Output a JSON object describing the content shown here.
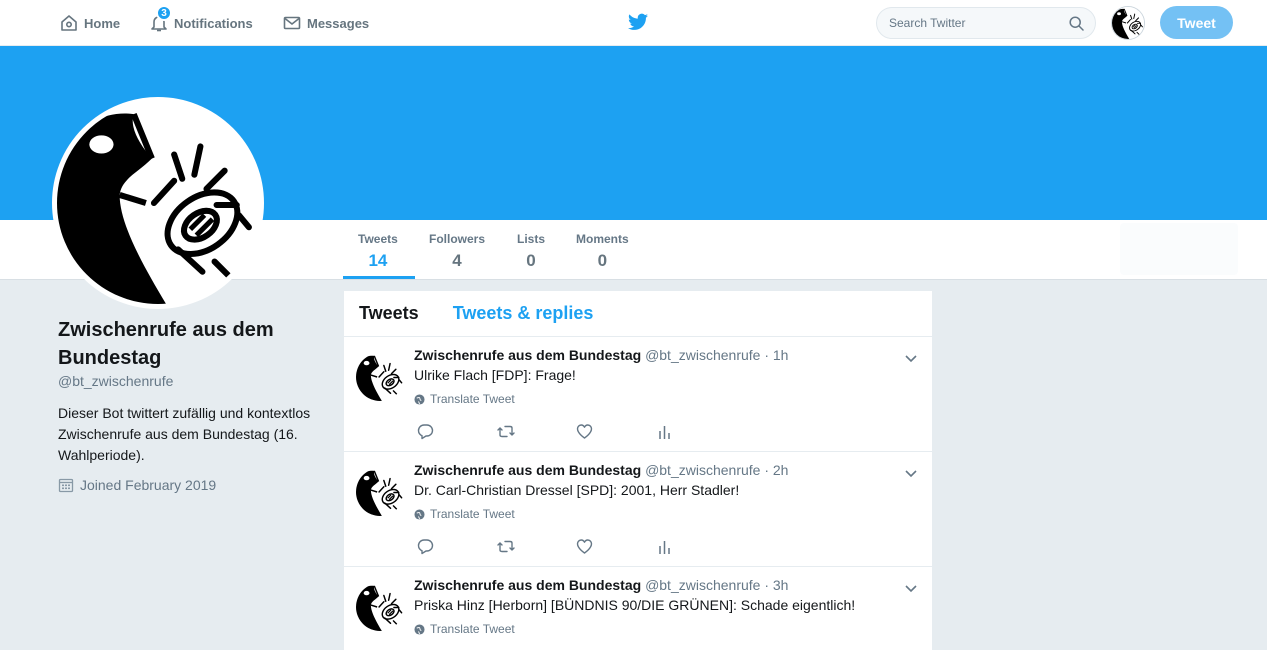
{
  "nav": {
    "home": "Home",
    "notifications": "Notifications",
    "notifications_badge": "3",
    "messages": "Messages",
    "search_placeholder": "Search Twitter",
    "tweet_button": "Tweet"
  },
  "colors": {
    "accent": "#1da1f2",
    "text": "#14171a",
    "muted": "#657786",
    "background": "#e6ecf0"
  },
  "stats": [
    {
      "label": "Tweets",
      "value": "14"
    },
    {
      "label": "Followers",
      "value": "4"
    },
    {
      "label": "Lists",
      "value": "0"
    },
    {
      "label": "Moments",
      "value": "0"
    }
  ],
  "profile": {
    "name": "Zwischenrufe aus dem Bundestag",
    "handle": "@bt_zwischenrufe",
    "bio": "Dieser Bot twittert zufällig und kontextlos Zwischenrufe aus dem Bundestag (16. Wahlperiode).",
    "joined": "Joined February 2019"
  },
  "timeline": {
    "tabs": [
      "Tweets",
      "Tweets & replies"
    ],
    "translate_label": "Translate Tweet",
    "tweets": [
      {
        "name": "Zwischenrufe aus dem Bundestag",
        "handle": "@bt_zwischenrufe",
        "time": "· 1h",
        "text": "Ulrike Flach [FDP]: Frage!"
      },
      {
        "name": "Zwischenrufe aus dem Bundestag",
        "handle": "@bt_zwischenrufe",
        "time": "· 2h",
        "text": "Dr. Carl-Christian Dressel [SPD]: 2001, Herr Stadler!"
      },
      {
        "name": "Zwischenrufe aus dem Bundestag",
        "handle": "@bt_zwischenrufe",
        "time": "· 3h",
        "text": "Priska Hinz [Herborn] [BÜNDNIS 90/DIE GRÜNEN]: Schade eigentlich!"
      }
    ]
  }
}
